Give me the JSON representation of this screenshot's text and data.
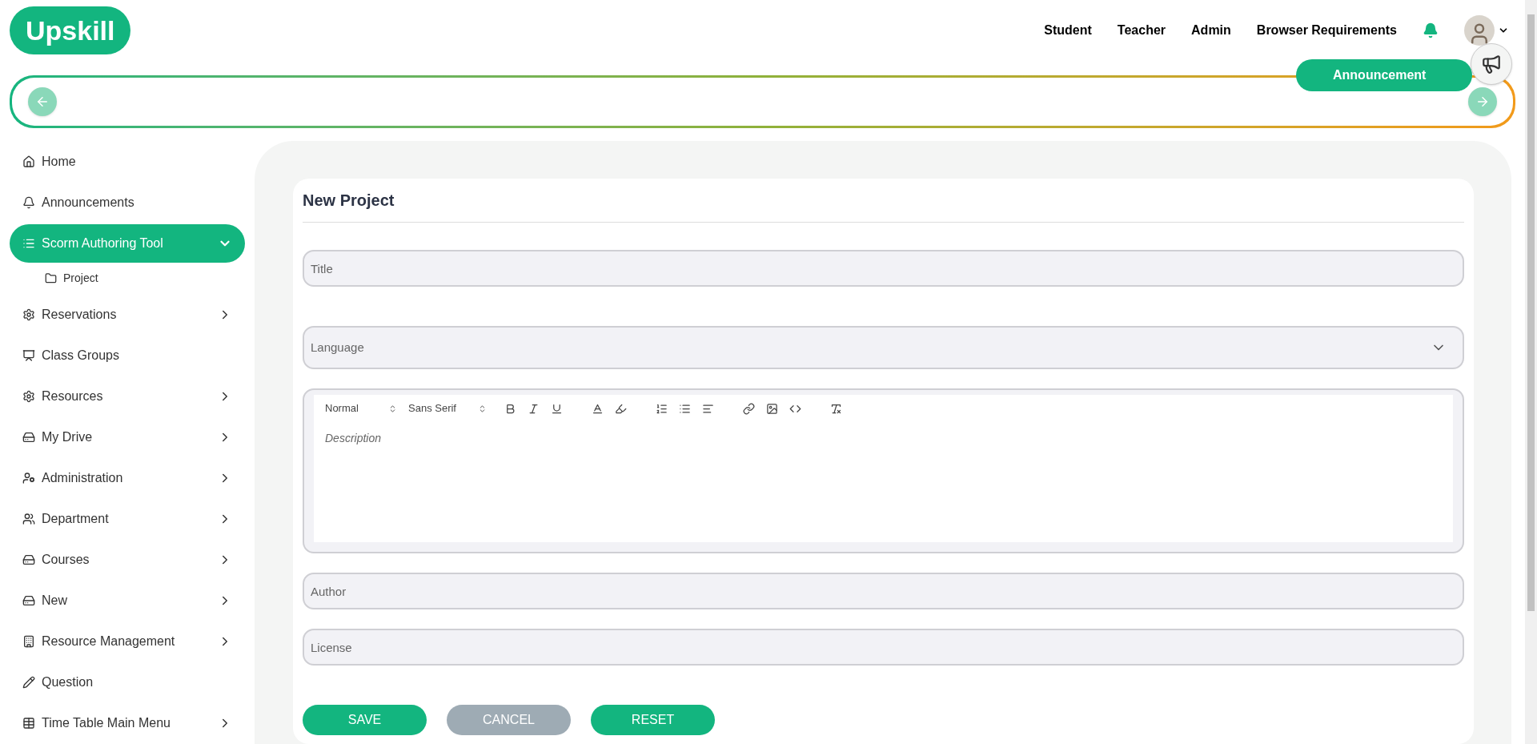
{
  "logo": {
    "text": "Upskill"
  },
  "top_nav": [
    "Student",
    "Teacher",
    "Admin",
    "Browser Requirements"
  ],
  "announcement": {
    "label": "Announcement"
  },
  "sidebar": {
    "items": [
      {
        "label": "Home",
        "selected": false,
        "has_submenu": false
      },
      {
        "label": "Announcements",
        "selected": false,
        "has_submenu": false
      },
      {
        "label": "Scorm Authoring Tool",
        "selected": true,
        "has_submenu": true,
        "expanded": true,
        "children": [
          {
            "label": "Project",
            "selected": false
          }
        ]
      },
      {
        "label": "Reservations",
        "selected": false,
        "has_submenu": true,
        "expanded": false
      },
      {
        "label": "Class Groups",
        "selected": false,
        "has_submenu": false
      },
      {
        "label": "Resources",
        "selected": false,
        "has_submenu": true,
        "expanded": false
      },
      {
        "label": "My Drive",
        "selected": false,
        "has_submenu": true,
        "expanded": false
      },
      {
        "label": "Administration",
        "selected": false,
        "has_submenu": true,
        "expanded": false
      },
      {
        "label": "Department",
        "selected": false,
        "has_submenu": true,
        "expanded": false
      },
      {
        "label": "Courses",
        "selected": false,
        "has_submenu": true,
        "expanded": false
      },
      {
        "label": "New",
        "selected": false,
        "has_submenu": true,
        "expanded": false
      },
      {
        "label": "Resource Management",
        "selected": false,
        "has_submenu": true,
        "expanded": false
      },
      {
        "label": "Question",
        "selected": false,
        "has_submenu": false
      },
      {
        "label": "Time Table Main Menu",
        "selected": false,
        "has_submenu": true,
        "expanded": false
      }
    ]
  },
  "form": {
    "title": "New Project",
    "fields": [
      {
        "kind": "text",
        "placeholder": "Title"
      },
      {
        "kind": "select",
        "placeholder": "Language"
      },
      {
        "kind": "editor",
        "placeholder": "Description",
        "header_format": "Normal",
        "font": "Sans Serif"
      },
      {
        "kind": "text",
        "placeholder": "Author"
      },
      {
        "kind": "text",
        "placeholder": "License"
      }
    ],
    "buttons": [
      {
        "label": "SAVE",
        "kind": "primary"
      },
      {
        "label": "CANCEL",
        "kind": "secondary"
      },
      {
        "label": "RESET",
        "kind": "primary"
      }
    ]
  }
}
